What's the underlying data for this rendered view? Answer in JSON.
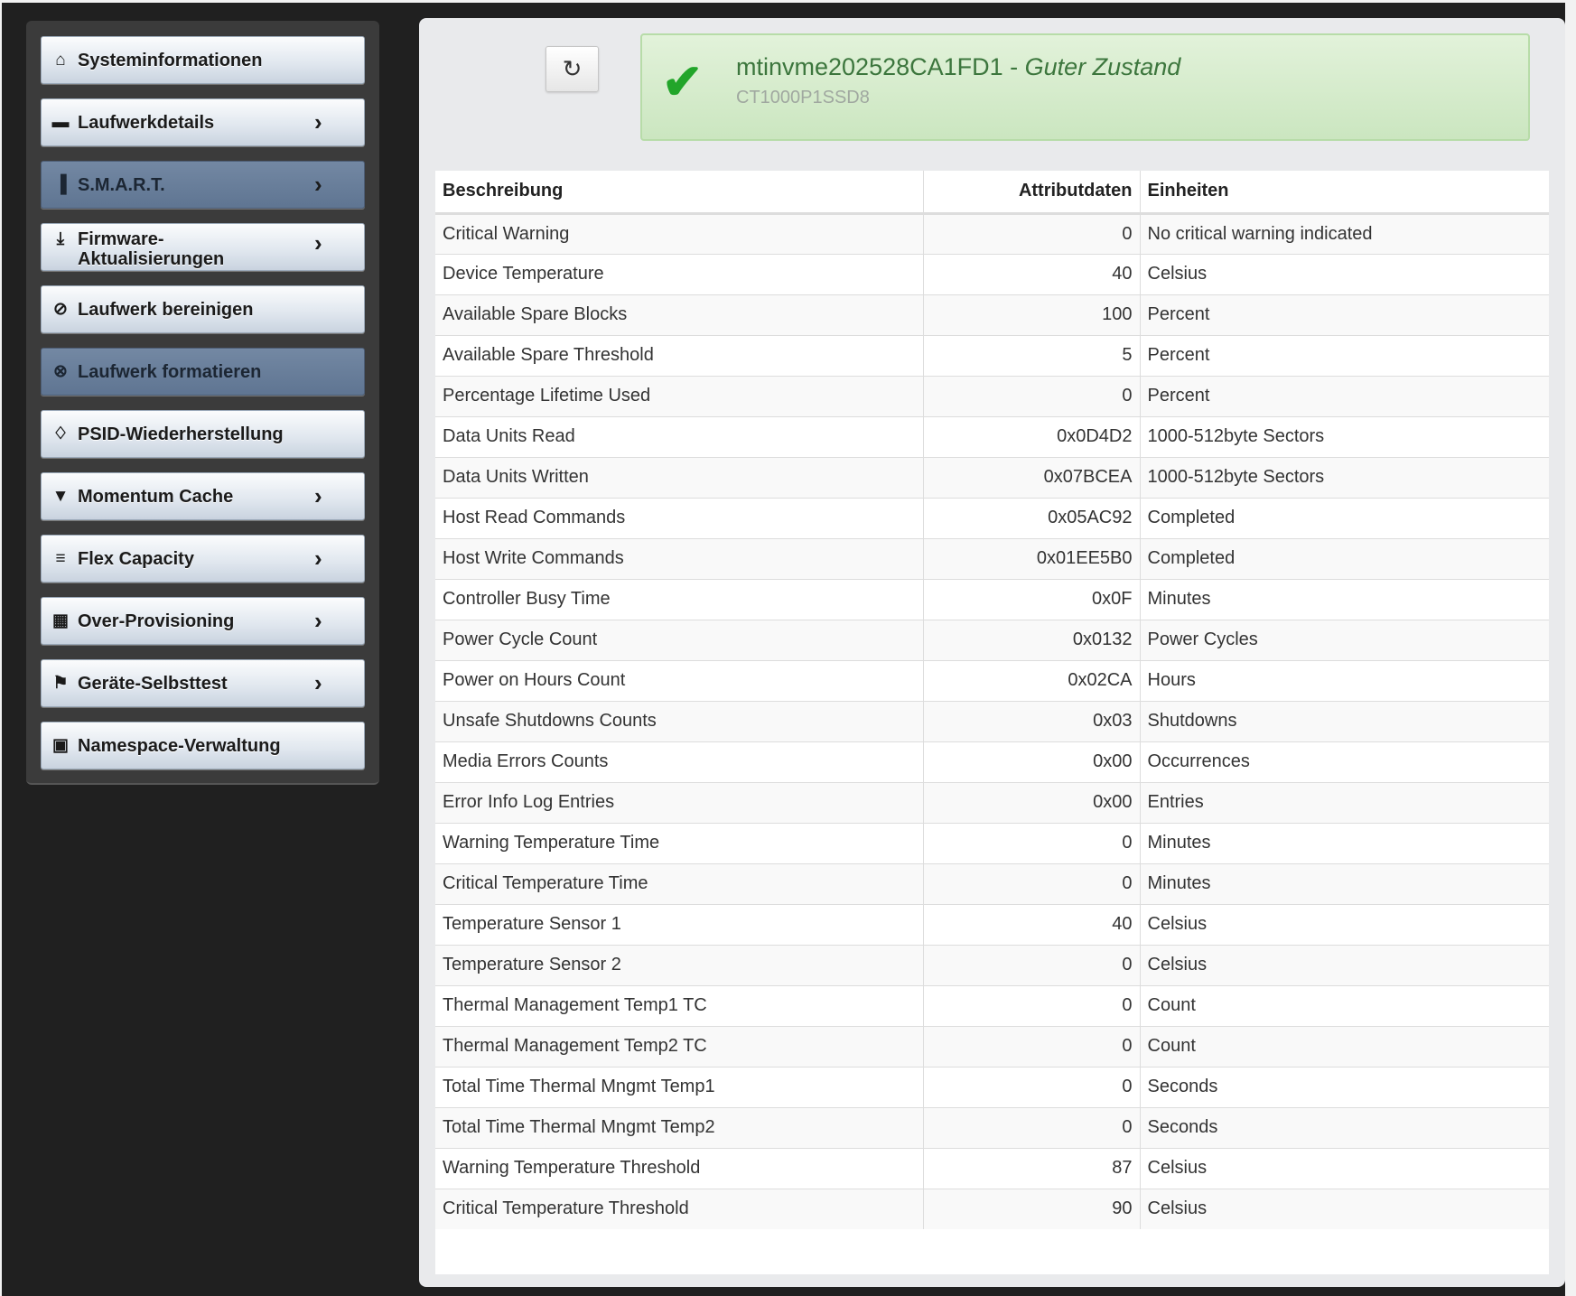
{
  "sidebar": {
    "items": [
      {
        "label": "Systeminformationen",
        "icon": "home-icon",
        "chevron": false,
        "active": false
      },
      {
        "label": "Laufwerkdetails",
        "icon": "drive-icon",
        "chevron": true,
        "active": false
      },
      {
        "label": "S.M.A.R.T.",
        "icon": "bar-chart-icon",
        "chevron": true,
        "active": true
      },
      {
        "label": "Firmware-\nAktualisierungen",
        "icon": "download-icon",
        "chevron": true,
        "active": false
      },
      {
        "label": "Laufwerk bereinigen",
        "icon": "ban-icon",
        "chevron": false,
        "active": false
      },
      {
        "label": "Laufwerk formatieren",
        "icon": "circle-x-icon",
        "chevron": false,
        "active": true
      },
      {
        "label": "PSID-Wiederherstellung",
        "icon": "eye-slash-icon",
        "chevron": false,
        "active": false
      },
      {
        "label": "Momentum Cache",
        "icon": "filter-icon",
        "chevron": true,
        "active": false
      },
      {
        "label": "Flex Capacity",
        "icon": "align-left-icon",
        "chevron": true,
        "active": false
      },
      {
        "label": "Over-Provisioning",
        "icon": "grid-icon",
        "chevron": true,
        "active": false
      },
      {
        "label": "Geräte-Selbsttest",
        "icon": "flag-icon",
        "chevron": true,
        "active": false
      },
      {
        "label": "Namespace-Verwaltung",
        "icon": "briefcase-icon",
        "chevron": false,
        "active": false
      }
    ]
  },
  "status": {
    "device": "mtinvme202528CA1FD1",
    "separator": " - ",
    "state": "Guter Zustand",
    "model": "CT1000P1SSD8",
    "color": "#3c763d"
  },
  "table": {
    "headers": [
      "Beschreibung",
      "Attributdaten",
      "Einheiten"
    ],
    "rows": [
      [
        "Critical Warning",
        "0",
        "No critical warning indicated"
      ],
      [
        "Device Temperature",
        "40",
        "Celsius"
      ],
      [
        "Available Spare Blocks",
        "100",
        "Percent"
      ],
      [
        "Available Spare Threshold",
        "5",
        "Percent"
      ],
      [
        "Percentage Lifetime Used",
        "0",
        "Percent"
      ],
      [
        "Data Units Read",
        "0x0D4D2",
        "1000-512byte Sectors"
      ],
      [
        "Data Units Written",
        "0x07BCEA",
        "1000-512byte Sectors"
      ],
      [
        "Host Read Commands",
        "0x05AC92",
        "Completed"
      ],
      [
        "Host Write Commands",
        "0x01EE5B0",
        "Completed"
      ],
      [
        "Controller Busy Time",
        "0x0F",
        "Minutes"
      ],
      [
        "Power Cycle Count",
        "0x0132",
        "Power Cycles"
      ],
      [
        "Power on Hours Count",
        "0x02CA",
        "Hours"
      ],
      [
        "Unsafe Shutdowns Counts",
        "0x03",
        "Shutdowns"
      ],
      [
        "Media Errors Counts",
        "0x00",
        "Occurrences"
      ],
      [
        "Error Info Log Entries",
        "0x00",
        "Entries"
      ],
      [
        "Warning Temperature Time",
        "0",
        "Minutes"
      ],
      [
        "Critical Temperature Time",
        "0",
        "Minutes"
      ],
      [
        "Temperature Sensor 1",
        "40",
        "Celsius"
      ],
      [
        "Temperature Sensor 2",
        "0",
        "Celsius"
      ],
      [
        "Thermal Management Temp1 TC",
        "0",
        "Count"
      ],
      [
        "Thermal Management Temp2 TC",
        "0",
        "Count"
      ],
      [
        "Total Time Thermal Mngmt Temp1",
        "0",
        "Seconds"
      ],
      [
        "Total Time Thermal Mngmt Temp2",
        "0",
        "Seconds"
      ],
      [
        "Warning Temperature Threshold",
        "87",
        "Celsius"
      ],
      [
        "Critical Temperature Threshold",
        "90",
        "Celsius"
      ]
    ]
  }
}
